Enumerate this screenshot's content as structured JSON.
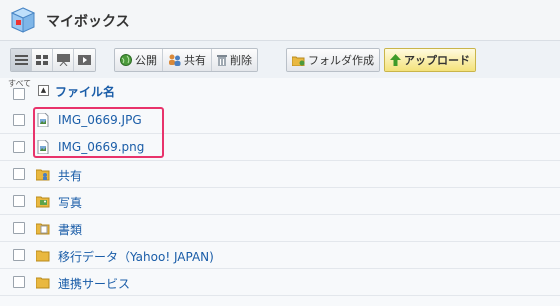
{
  "header": {
    "title": "マイボックス",
    "logo_icon": "mybox-logo-icon"
  },
  "toolbar": {
    "view_buttons": [
      "list-view-icon",
      "thumbnail-view-icon",
      "slideshow-view-icon",
      "play-icon"
    ],
    "publish_label": "公開",
    "share_label": "共有",
    "delete_label": "削除",
    "new_folder_label": "フォルダ作成",
    "upload_label": "アップロード"
  },
  "list": {
    "all_label": "すべて",
    "column_header": "ファイル名",
    "items": [
      {
        "name": "IMG_0669.JPG",
        "type": "file",
        "icon": "image-file-icon"
      },
      {
        "name": "IMG_0669.png",
        "type": "file",
        "icon": "image-file-icon"
      },
      {
        "name": "共有",
        "type": "folder",
        "icon": "shared-folder-icon"
      },
      {
        "name": "写真",
        "type": "folder",
        "icon": "photo-folder-icon"
      },
      {
        "name": "書類",
        "type": "folder",
        "icon": "document-folder-icon"
      },
      {
        "name": "移行データ（Yahoo! JAPAN)",
        "type": "folder",
        "icon": "folder-icon"
      },
      {
        "name": "連携サービス",
        "type": "folder",
        "icon": "folder-icon"
      }
    ]
  },
  "colors": {
    "link": "#1a5da8",
    "highlight": "#e8336b",
    "folder": "#e9b840"
  }
}
